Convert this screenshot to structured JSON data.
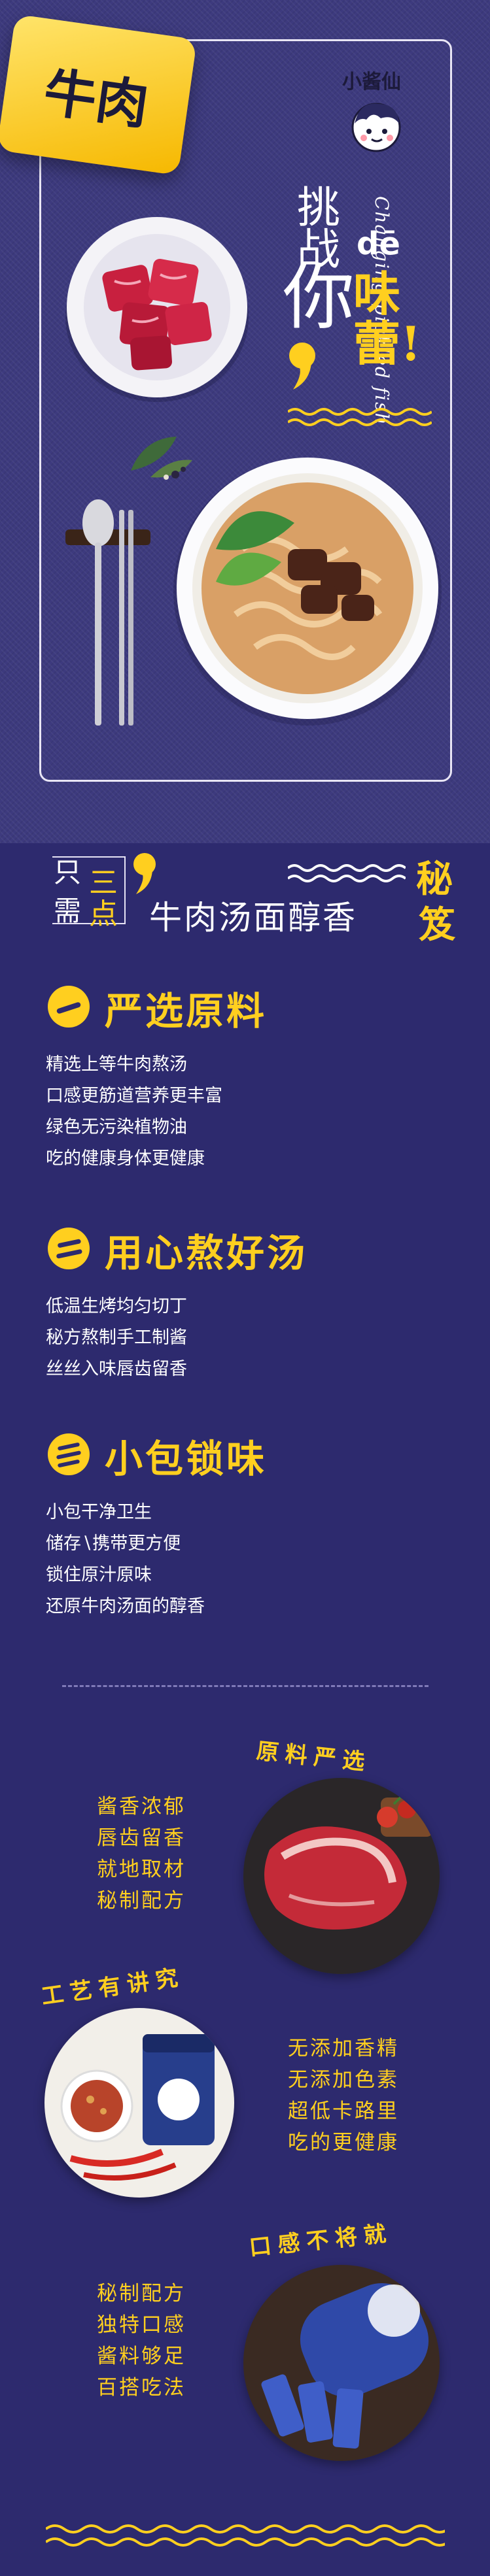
{
  "hero": {
    "badge": "牛肉",
    "brand": "小酱仙",
    "tiao_zhan": "挑战",
    "ni": "你",
    "de": "dē",
    "wei_lei": "味蕾",
    "exclaim": "!",
    "subtitle_en": "Changing pickled fish"
  },
  "secret": {
    "zhi": "只",
    "xu": "需",
    "san": "三",
    "dian": "点",
    "title": "牛肉汤面醇香",
    "mi": "秘",
    "ji": "笈"
  },
  "features": [
    {
      "title": "严选原料",
      "items": [
        "精选上等牛肉熬汤",
        "口感更筋道营养更丰富",
        "绿色无污染植物油",
        "吃的健康身体更健康"
      ]
    },
    {
      "title": "用心熬好汤",
      "items": [
        "低温生烤均匀切丁",
        "秘方熬制手工制酱",
        "丝丝入味唇齿留香"
      ]
    },
    {
      "title": "小包锁味",
      "items": [
        "小包干净卫生",
        "储存∖携带更方便",
        "锁住原汁原味",
        "还原牛肉汤面的醇香"
      ]
    }
  ],
  "products": [
    {
      "arc": "原料严选",
      "lines": [
        "酱香浓郁",
        "唇齿留香",
        "就地取材",
        "秘制配方"
      ]
    },
    {
      "arc": "工艺有讲究",
      "lines": [
        "无添加香精",
        "无添加色素",
        "超低卡路里",
        "吃的更健康"
      ]
    },
    {
      "arc": "口感不将就",
      "lines": [
        "秘制配方",
        "独特口感",
        "酱料够足",
        "百搭吃法"
      ]
    }
  ],
  "colors": {
    "bg": "#2d2a6e",
    "accent": "#ffcf1f",
    "text": "#ffffff"
  }
}
